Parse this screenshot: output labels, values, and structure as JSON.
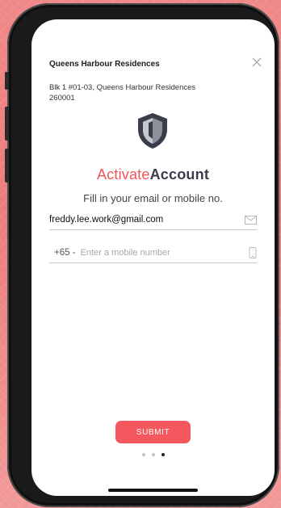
{
  "modal": {
    "title": "Queens Harbour Residences",
    "address": "Blk 1 #01-03, Queens Harbour Residences\n 260001",
    "close_icon": "close-icon"
  },
  "heading": {
    "activate": "Activate",
    "account": "Account"
  },
  "subtitle": "Fill in your email or mobile no.",
  "email_field": {
    "value": "freddy.lee.work@gmail.com",
    "icon": "envelope-icon"
  },
  "mobile_field": {
    "prefix": "+65 -",
    "placeholder": "Enter a mobile number",
    "icon": "mobile-phone-icon"
  },
  "submit_label": "SUBMIT",
  "pagination": {
    "total": 3,
    "active_index": 2
  },
  "colors": {
    "accent": "#f4575d",
    "heading_dark": "#3a3d4a",
    "background": "#ec7e7e"
  }
}
